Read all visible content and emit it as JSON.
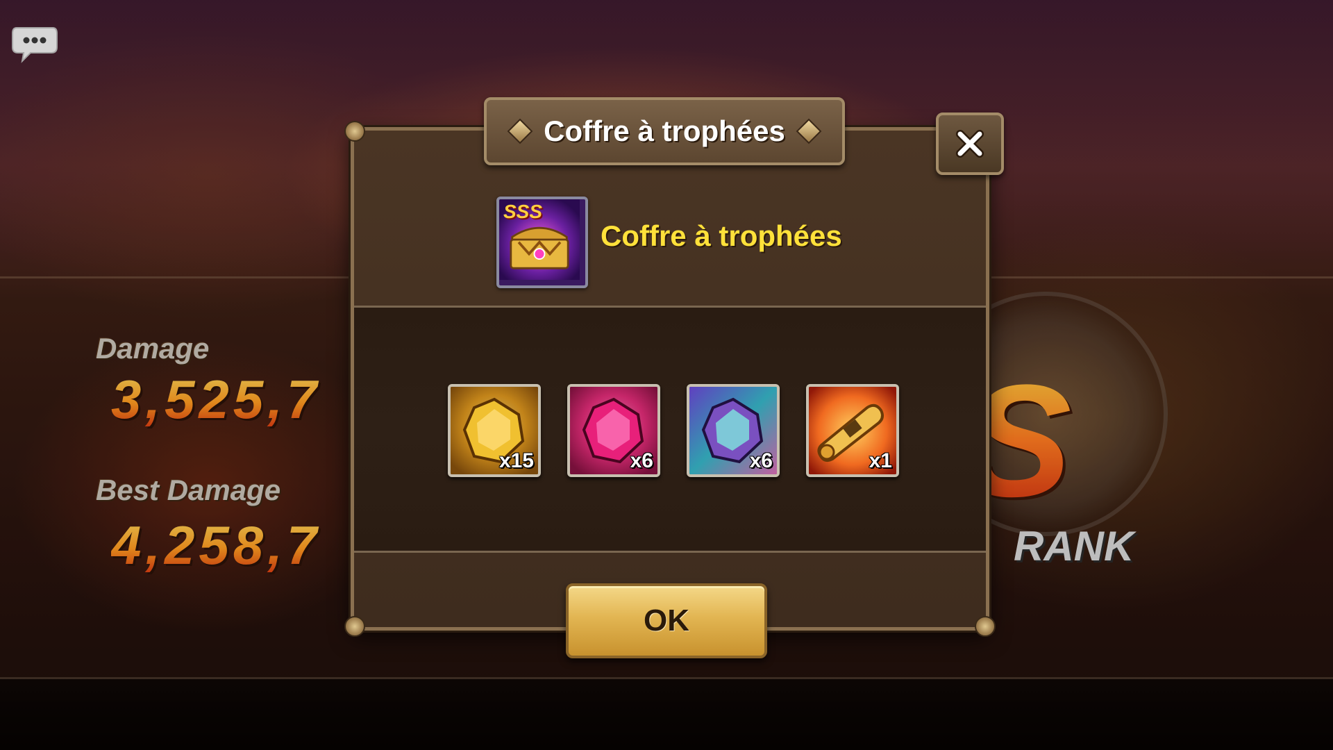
{
  "background": {
    "stats": {
      "damage_label": "Damage",
      "damage_value": "3,525,7",
      "best_damage_label": "Best Damage",
      "best_damage_value": "4,258,7"
    },
    "rank": {
      "letter": "S",
      "label": "RANK"
    }
  },
  "chat": {
    "icon": "chat-bubble-icon"
  },
  "modal": {
    "title": "Coffre à trophées",
    "close_icon": "close-icon",
    "chest": {
      "name": "Coffre à trophées",
      "icon": "trophy-chest-icon",
      "icon_text": "SSS"
    },
    "rewards": [
      {
        "icon": "gold-crystal-icon",
        "quantity": "x15",
        "color": "#e8a020"
      },
      {
        "icon": "pink-crystal-icon",
        "quantity": "x6",
        "color": "#e03080"
      },
      {
        "icon": "rainbow-crystal-icon",
        "quantity": "x6",
        "color": "#60d0d0"
      },
      {
        "icon": "scroll-icon",
        "quantity": "x1",
        "color": "#f0a030"
      }
    ],
    "ok_label": "OK"
  }
}
